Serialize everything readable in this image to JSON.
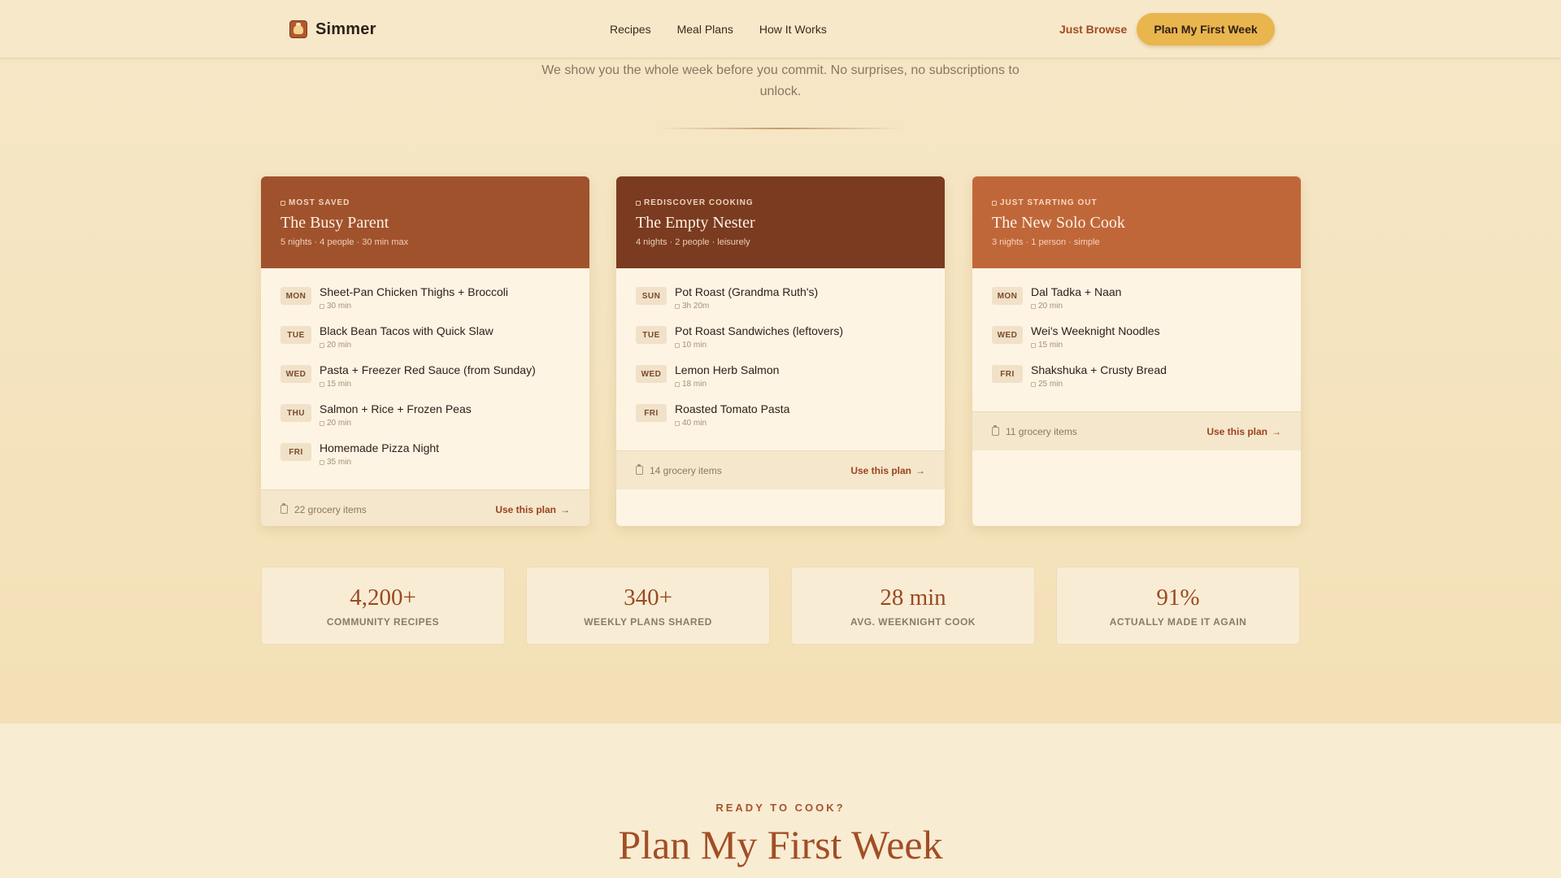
{
  "header": {
    "brand": "Simmer",
    "nav": [
      "Recipes",
      "Meal Plans",
      "How It Works"
    ],
    "browse_label": "Just Browse",
    "cta_label": "Plan My First Week"
  },
  "intro": {
    "text": "We show you the whole week before you commit. No surprises, no subscriptions to unlock."
  },
  "plans": [
    {
      "tag": "MOST SAVED",
      "title": "The Busy Parent",
      "subtitle": "5 nights · 4 people · 30 min max",
      "color": "#a0522d",
      "meals": [
        {
          "day": "MON",
          "name": "Sheet-Pan Chicken Thighs + Broccoli",
          "time": "30 min"
        },
        {
          "day": "TUE",
          "name": "Black Bean Tacos with Quick Slaw",
          "time": "20 min"
        },
        {
          "day": "WED",
          "name": "Pasta + Freezer Red Sauce (from Sunday)",
          "time": "15 min"
        },
        {
          "day": "THU",
          "name": "Salmon + Rice + Frozen Peas",
          "time": "20 min"
        },
        {
          "day": "FRI",
          "name": "Homemade Pizza Night",
          "time": "35 min"
        }
      ],
      "grocery": "22 grocery items",
      "use_label": "Use this plan"
    },
    {
      "tag": "REDISCOVER COOKING",
      "title": "The Empty Nester",
      "subtitle": "4 nights · 2 people · leisurely",
      "color": "#7a3b20",
      "meals": [
        {
          "day": "SUN",
          "name": "Pot Roast (Grandma Ruth's)",
          "time": "3h 20m"
        },
        {
          "day": "TUE",
          "name": "Pot Roast Sandwiches (leftovers)",
          "time": "10 min"
        },
        {
          "day": "WED",
          "name": "Lemon Herb Salmon",
          "time": "18 min"
        },
        {
          "day": "FRI",
          "name": "Roasted Tomato Pasta",
          "time": "40 min"
        }
      ],
      "grocery": "14 grocery items",
      "use_label": "Use this plan"
    },
    {
      "tag": "JUST STARTING OUT",
      "title": "The New Solo Cook",
      "subtitle": "3 nights · 1 person · simple",
      "color": "#c0673a",
      "meals": [
        {
          "day": "MON",
          "name": "Dal Tadka + Naan",
          "time": "20 min"
        },
        {
          "day": "WED",
          "name": "Wei's Weeknight Noodles",
          "time": "15 min"
        },
        {
          "day": "FRI",
          "name": "Shakshuka + Crusty Bread",
          "time": "25 min"
        }
      ],
      "grocery": "11 grocery items",
      "use_label": "Use this plan"
    }
  ],
  "stats": [
    {
      "value": "4,200+",
      "label": "COMMUNITY RECIPES"
    },
    {
      "value": "340+",
      "label": "WEEKLY PLANS SHARED"
    },
    {
      "value": "28 min",
      "label": "AVG. WEEKNIGHT COOK"
    },
    {
      "value": "91%",
      "label": "ACTUALLY MADE IT AGAIN"
    }
  ],
  "closing": {
    "eyebrow": "READY TO COOK?",
    "title": "Plan My First Week"
  }
}
